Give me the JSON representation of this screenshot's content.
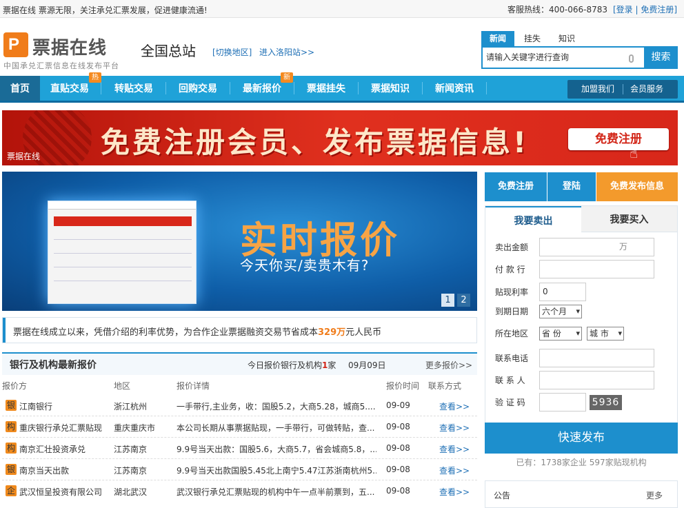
{
  "topbar": {
    "slogan": "票据在线  票源无限，关注承兑汇票发展，促进健康流通!",
    "hotline": "客服热线：400-066-8783",
    "login_links": "[登录 | 免费注册]"
  },
  "header": {
    "logo_text": "票据在线",
    "logo_subtitle": "中国承兑汇票信息在线发布平台",
    "station": "全国总站",
    "switch_area": "[切换地区]",
    "enter_station": "进入洛阳站>>"
  },
  "search": {
    "tabs": [
      "新闻",
      "挂失",
      "知识"
    ],
    "active_tab": 0,
    "placeholder": "请输入关键字进行查询",
    "button": "搜索"
  },
  "nav": {
    "items": [
      {
        "label": "首页",
        "badge": ""
      },
      {
        "label": "直贴交易",
        "badge": "热"
      },
      {
        "label": "转贴交易",
        "badge": ""
      },
      {
        "label": "回购交易",
        "badge": ""
      },
      {
        "label": "最新报价",
        "badge": "新"
      },
      {
        "label": "票据挂失",
        "badge": ""
      },
      {
        "label": "票据知识",
        "badge": ""
      },
      {
        "label": "新闻资讯",
        "badge": ""
      }
    ],
    "join": "加盟我们",
    "member": "会员服务"
  },
  "banner": {
    "text": "免费注册会员、发布票据信息!",
    "button": "免费注册",
    "corner": "票据在线"
  },
  "slider": {
    "title": "实时报价",
    "subtitle": "今天你买/卖贵木有?",
    "pages": [
      "1",
      "2"
    ]
  },
  "savings": {
    "prefix": "票据在线成立以来，凭借介绍的利率优势，为合作企业票据融资交易节省成本",
    "amount": "329万",
    "suffix": "元人民币"
  },
  "quotes": {
    "title": "银行及机构最新报价",
    "today_prefix": "今日报价银行及机构",
    "today_count": "1",
    "today_suffix": "家",
    "date": "09月09日",
    "more": "更多报价>>",
    "headers": [
      "报价方",
      "地区",
      "报价详情",
      "报价时间",
      "联系方式"
    ],
    "rows": [
      {
        "tag": "银",
        "name": "江南银行",
        "area": "浙江杭州",
        "detail": "一手带行,主业务，收：国股5.2，大商5.28，城商5....",
        "time": "09-09",
        "link": "查看>>"
      },
      {
        "tag": "构",
        "name": "重庆银行承兑汇票贴现",
        "area": "重庆重庆市",
        "detail": "本公司长期从事票据贴现，一手带行，可做转贴，查...",
        "time": "09-08",
        "link": "查看>>"
      },
      {
        "tag": "构",
        "name": "南京汇壮投资承兑",
        "area": "江苏南京",
        "detail": "9.9号当天出款：国股5.6，大商5.7，省会城商5.8，...",
        "time": "09-08",
        "link": "查看>>"
      },
      {
        "tag": "银",
        "name": "南京当天出款",
        "area": "江苏南京",
        "detail": "9.9号当天出款国股5.45北上南宁5.47江苏浙南杭州5...",
        "time": "09-08",
        "link": "查看>>"
      },
      {
        "tag": "企",
        "name": "武汉恒呈投资有限公司",
        "area": "湖北武汉",
        "detail": "武汉银行承兑汇票贴现的机构中午一点半前票到，五...",
        "time": "09-08",
        "link": "查看>>"
      }
    ]
  },
  "right": {
    "tabs": [
      "免费注册",
      "登陆",
      "免费发布信息"
    ],
    "form_tabs": [
      "我要卖出",
      "我要买入"
    ],
    "labels": {
      "amount": "卖出金额",
      "payer": "付 款 行",
      "rate": "贴现利率",
      "due": "到期日期",
      "region": "所在地区",
      "phone": "联系电话",
      "contact": "联 系 人",
      "code": "验 证 码"
    },
    "amount_unit": "万",
    "rate_value": "0",
    "due_value": "六个月",
    "province": "省 份",
    "city": "城 市",
    "captcha": "5936",
    "quick_publish": "快速发布",
    "stats": "已有：1738家企业  597家贴现机构",
    "notice": "公告",
    "notice_more": "更多"
  },
  "colors": {
    "brand_blue": "#1d8fcd",
    "nav_blue": "#1fa2d8",
    "accent_orange": "#f07c1a",
    "banner_red": "#d8271a"
  }
}
